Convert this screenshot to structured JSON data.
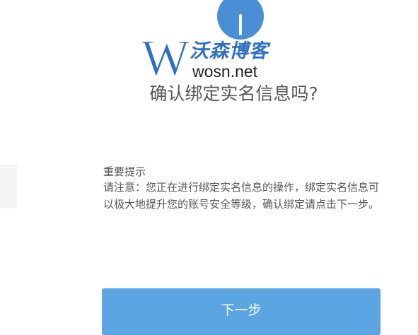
{
  "watermark": {
    "letter": "W",
    "brand": "沃森博客",
    "domain": "wosn.net"
  },
  "dialog": {
    "title": "确认绑定实名信息吗?",
    "notice_heading": "重要提示",
    "notice_body": "请注意：您正在进行绑定实名信息的操作，绑定实名信息可以极大地提升您的账号安全等级，确认绑定请点击下一步。",
    "next_button": "下一步"
  },
  "colors": {
    "accent": "#5ba5e3",
    "icon_blue": "#4a8fd6",
    "watermark_blue": "#2e6ec3",
    "text_gray": "#555555"
  },
  "icons": {
    "top": "info-circle-icon"
  }
}
